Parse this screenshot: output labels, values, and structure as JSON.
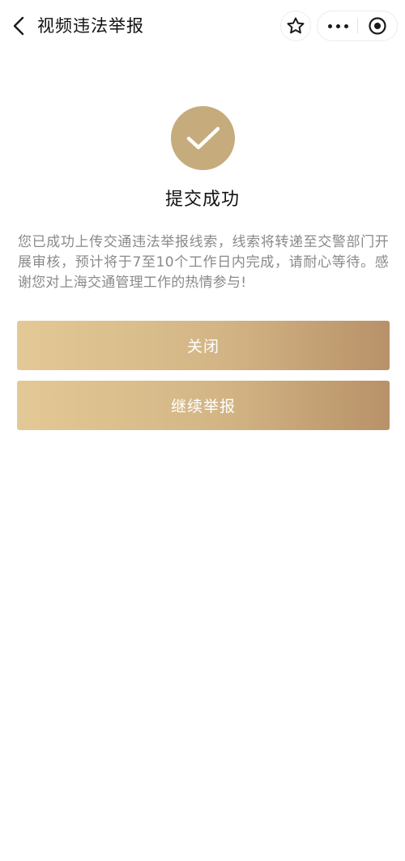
{
  "navbar": {
    "title": "视频违法举报",
    "icons": {
      "back": "chevron-left-icon",
      "star": "star-icon",
      "more": "more-dots-icon",
      "close": "target-circle-icon"
    }
  },
  "result": {
    "icon": "checkmark-icon",
    "icon_color": "#c6ab7d",
    "title": "提交成功",
    "message": "您已成功上传交通违法举报线索，线索将转递至交警部门开展审核，预计将于7至10个工作日内完成，请耐心等待。感谢您对上海交通管理工作的热情参与!"
  },
  "actions": {
    "close_label": "关闭",
    "continue_label": "继续举报",
    "gradient_start": "#e3c995",
    "gradient_end": "#b89168"
  }
}
